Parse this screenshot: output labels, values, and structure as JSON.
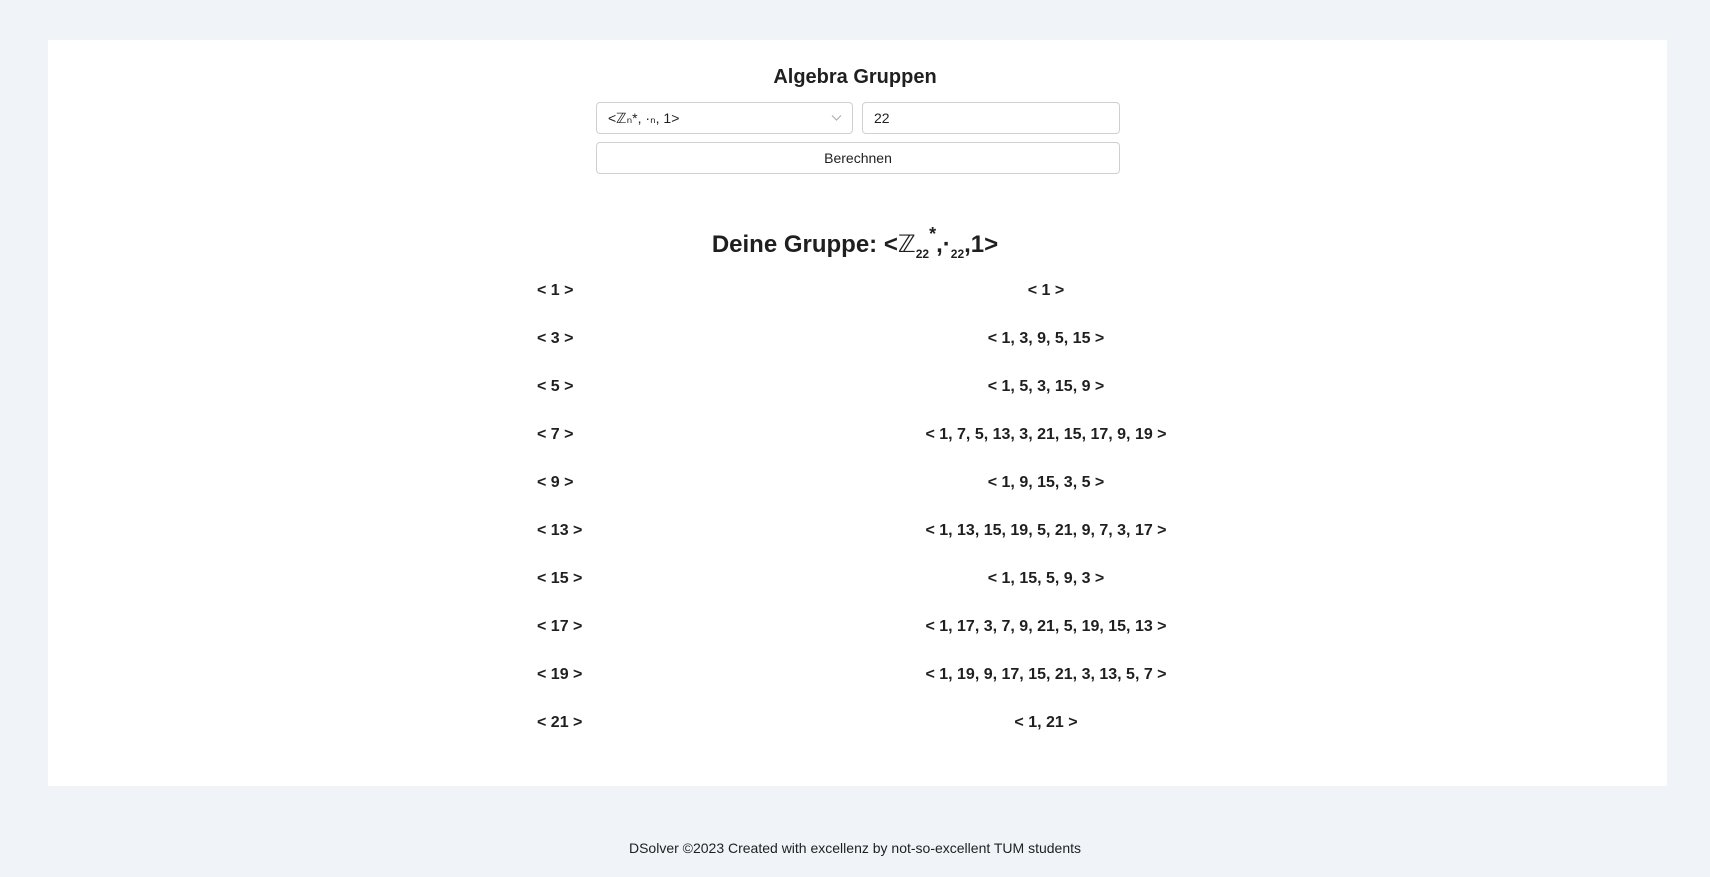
{
  "header": {
    "title": "Algebra Gruppen"
  },
  "form": {
    "select_value": "<ℤₙ*, ·ₙ, 1>",
    "number_value": "22",
    "button_label": "Berechnen"
  },
  "result": {
    "heading_prefix": "Deine Gruppe: <",
    "heading_symbol": "ℤ",
    "heading_sub1": "22",
    "heading_sup": "*",
    "heading_op": ",·",
    "heading_sub2": "22",
    "heading_suffix": ",1>",
    "rows": [
      {
        "generator": "< 1 >",
        "subgroup": "< 1 >"
      },
      {
        "generator": "< 3 >",
        "subgroup": "< 1, 3, 9, 5, 15 >"
      },
      {
        "generator": "< 5 >",
        "subgroup": "< 1, 5, 3, 15, 9 >"
      },
      {
        "generator": "< 7 >",
        "subgroup": "< 1, 7, 5, 13, 3, 21, 15, 17, 9, 19 >"
      },
      {
        "generator": "< 9 >",
        "subgroup": "< 1, 9, 15, 3, 5 >"
      },
      {
        "generator": "< 13 >",
        "subgroup": "< 1, 13, 15, 19, 5, 21, 9, 7, 3, 17 >"
      },
      {
        "generator": "< 15 >",
        "subgroup": "< 1, 15, 5, 9, 3 >"
      },
      {
        "generator": "< 17 >",
        "subgroup": "< 1, 17, 3, 7, 9, 21, 5, 19, 15, 13 >"
      },
      {
        "generator": "< 19 >",
        "subgroup": "< 1, 19, 9, 17, 15, 21, 3, 13, 5, 7 >"
      },
      {
        "generator": "< 21 >",
        "subgroup": "< 1, 21 >"
      }
    ]
  },
  "footer": {
    "text": "DSolver ©2023 Created with excellenz by not-so-excellent TUM students"
  }
}
